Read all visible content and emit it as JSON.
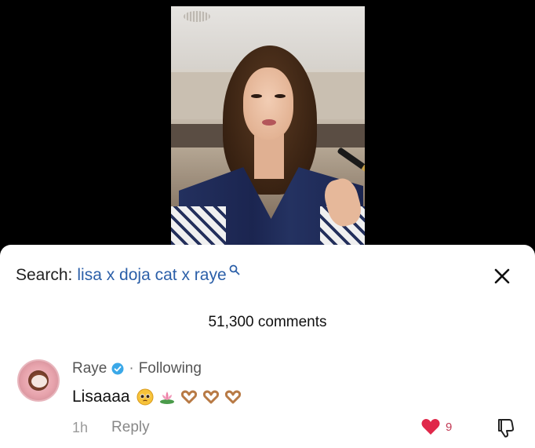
{
  "video": {
    "alt": "makeup video frame"
  },
  "search": {
    "prefix": "Search:",
    "term": "lisa x doja cat x raye",
    "icon": "search-icon"
  },
  "close": {
    "icon": "close-icon"
  },
  "comments": {
    "count_label": "51,300 comments"
  },
  "comment": {
    "author": "Raye",
    "separator": "·",
    "relation": "Following",
    "text": "Lisaaaa",
    "emojis": [
      "pleading-face-emoji",
      "lotus-emoji",
      "heart-hands-emoji",
      "heart-hands-emoji",
      "heart-hands-emoji"
    ],
    "time": "1h",
    "reply_label": "Reply",
    "like_count": "9"
  },
  "colors": {
    "link_blue": "#2b5fa8",
    "like_red": "#e0284a",
    "verified": "#3aa8e8"
  }
}
